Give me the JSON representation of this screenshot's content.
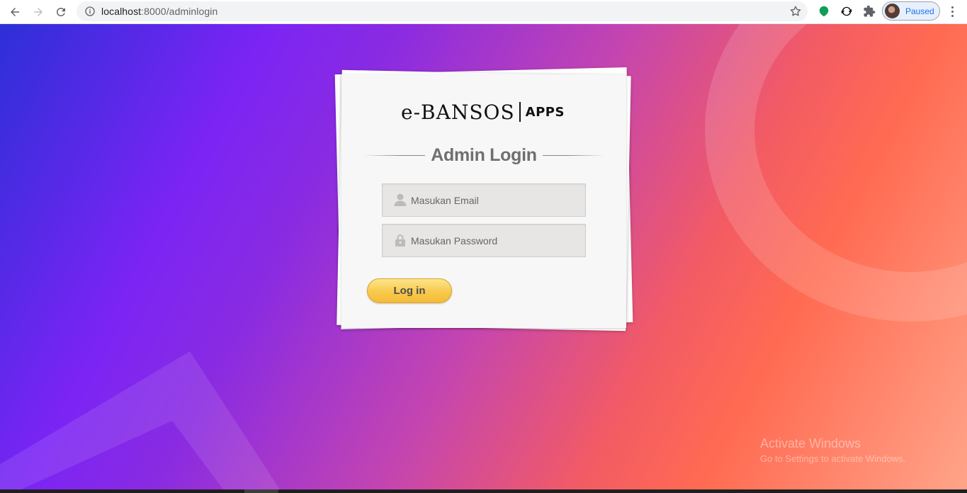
{
  "browser": {
    "url_host": "localhost",
    "url_rest": ":8000/adminlogin",
    "profile_status": "Paused"
  },
  "login": {
    "logo_brand": "e-BANSOS",
    "logo_suffix": "APPS",
    "title": "Admin Login",
    "email_placeholder": "Masukan Email",
    "password_placeholder": "Masukan Password",
    "submit_label": "Log in"
  },
  "watermark": {
    "line1": "Activate Windows",
    "line2": "Go to Settings to activate Windows."
  },
  "colors": {
    "button_gradient_top": "#fde58a",
    "button_gradient_bottom": "#f5bb36",
    "background_start": "#2d2fd8",
    "background_mid": "#8a2be2",
    "background_end": "#ff6b52"
  }
}
